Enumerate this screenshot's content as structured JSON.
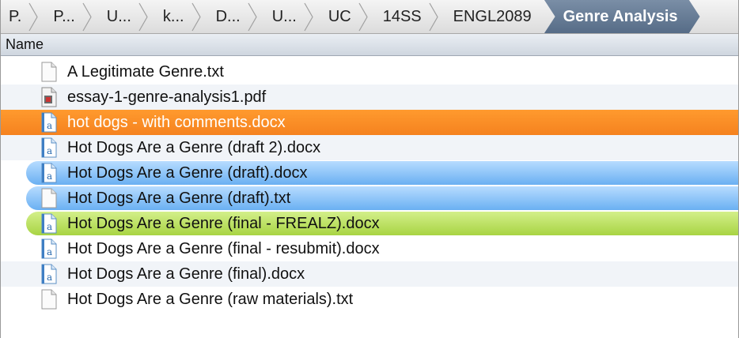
{
  "breadcrumb": {
    "items": [
      {
        "label": "P."
      },
      {
        "label": "P..."
      },
      {
        "label": "U..."
      },
      {
        "label": "k..."
      },
      {
        "label": "D..."
      },
      {
        "label": "U..."
      },
      {
        "label": "UC"
      },
      {
        "label": "14SS"
      },
      {
        "label": "ENGL2089"
      }
    ],
    "current": "Genre Analysis"
  },
  "columns": {
    "name": "Name"
  },
  "files": [
    {
      "name": "A Legitimate Genre.txt",
      "icon": "text-file-icon",
      "label_color": "none"
    },
    {
      "name": "essay-1-genre-analysis1.pdf",
      "icon": "pdf-file-icon",
      "label_color": "none"
    },
    {
      "name": "hot dogs - with comments.docx",
      "icon": "word-document-icon",
      "label_color": "orange"
    },
    {
      "name": "Hot Dogs Are a Genre (draft 2).docx",
      "icon": "word-document-icon",
      "label_color": "none"
    },
    {
      "name": "Hot Dogs Are a Genre (draft).docx",
      "icon": "word-document-icon",
      "label_color": "blue"
    },
    {
      "name": "Hot Dogs Are a Genre (draft).txt",
      "icon": "text-file-icon",
      "label_color": "blue"
    },
    {
      "name": "Hot Dogs Are a Genre (final - FREALZ).docx",
      "icon": "word-document-icon",
      "label_color": "green"
    },
    {
      "name": "Hot Dogs Are a Genre (final - resubmit).docx",
      "icon": "word-document-icon",
      "label_color": "none"
    },
    {
      "name": "Hot Dogs Are a Genre (final).docx",
      "icon": "word-document-icon",
      "label_color": "none"
    },
    {
      "name": "Hot Dogs Are a Genre (raw materials).txt",
      "icon": "text-file-icon",
      "label_color": "none"
    }
  ],
  "colors": {
    "orange_label": "#f5821f",
    "blue_label": "#6ab0f2",
    "green_label": "#a8d443",
    "path_current": "#556b86"
  }
}
